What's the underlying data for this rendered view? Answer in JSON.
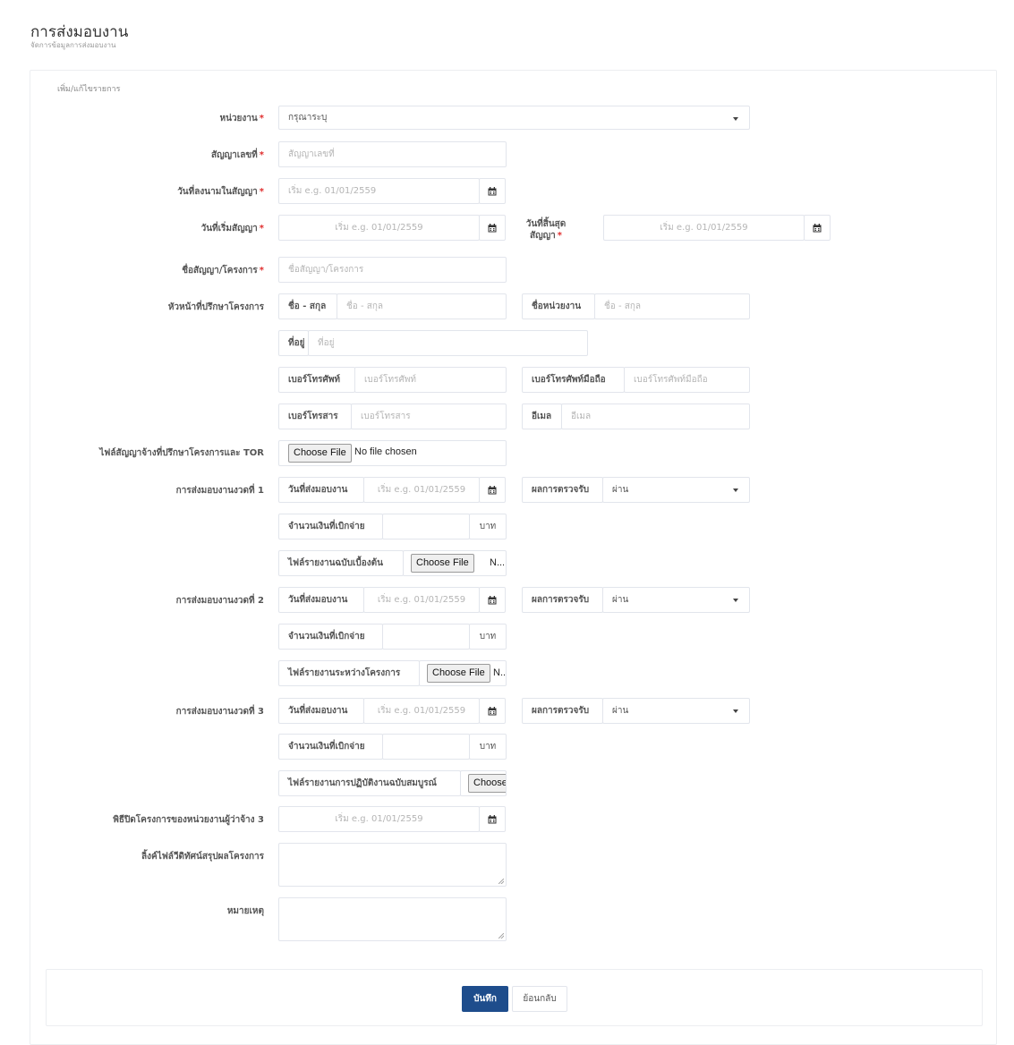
{
  "header": {
    "title": "การส่งมอบงาน",
    "subtitle": "จัดการข้อมูลการส่งมอบงาน"
  },
  "form": {
    "caption": "เพิ่ม/แก้ไขรายการ",
    "required_mark": "*",
    "agency": {
      "label": "หน่วยงาน",
      "value": "กรุณาระบุ"
    },
    "contract_no": {
      "label": "สัญญาเลขที่",
      "placeholder": "สัญญาเลขที่"
    },
    "sign_date": {
      "label": "วันที่ลงนามในสัญญา",
      "placeholder": "เริ่ม e.g. 01/01/2559"
    },
    "start_date": {
      "label": "วันที่เริ่มสัญญา",
      "placeholder": "เริ่ม e.g. 01/01/2559"
    },
    "end_date": {
      "label_line1": "วันที่สิ้นสุด",
      "label_line2": "สัญญา",
      "placeholder": "เริ่ม e.g. 01/01/2559"
    },
    "contract_name": {
      "label": "ชื่อสัญญา/โครงการ",
      "placeholder": "ชื่อสัญญา/โครงการ"
    },
    "advisor": {
      "label": "หัวหน้าที่ปรึกษาโครงการ",
      "name_addon": "ชื่อ - สกุล",
      "name_placeholder": "ชื่อ - สกุล",
      "org_addon": "ชื่อหน่วยงาน",
      "org_placeholder": "ชื่อ - สกุล",
      "address_addon": "ที่อยู่",
      "address_placeholder": "ที่อยู่",
      "phone_addon": "เบอร์โทรศัพท์",
      "phone_placeholder": "เบอร์โทรศัพท์",
      "mobile_addon": "เบอร์โทรศัพท์มือถือ",
      "mobile_placeholder": "เบอร์โทรศัพท์มือถือ",
      "fax_addon": "เบอร์โทรสาร",
      "fax_placeholder": "เบอร์โทรสาร",
      "email_addon": "อีเมล",
      "email_placeholder": "อีเมล"
    },
    "tor_file": {
      "label": "ไฟล์สัญญาจ้างที่ปรึกษาโครงการและ TOR",
      "button": "Choose File",
      "status": "No file chosen"
    },
    "installments": [
      {
        "label": "การส่งมอบงานงวดที่ 1",
        "date_addon": "วันที่ส่งมอบงาน",
        "date_placeholder": "เริ่ม e.g. 01/01/2559",
        "result_addon": "ผลการตรวจรับ",
        "result_value": "ผ่าน",
        "amount_addon": "จำนวนเงินที่เบิกจ่าย",
        "currency": "บาท",
        "file_addon": "ไฟล์รายงานฉบับเบื้องต้น",
        "file_button": "Choose File",
        "file_status": "N..."
      },
      {
        "label": "การส่งมอบงานงวดที่ 2",
        "date_addon": "วันที่ส่งมอบงาน",
        "date_placeholder": "เริ่ม e.g. 01/01/2559",
        "result_addon": "ผลการตรวจรับ",
        "result_value": "ผ่าน",
        "amount_addon": "จำนวนเงินที่เบิกจ่าย",
        "currency": "บาท",
        "file_addon": "ไฟล์รายงานระหว่างโครงการ",
        "file_button": "Choose File",
        "file_status": "N..."
      },
      {
        "label": "การส่งมอบงานงวดที่ 3",
        "date_addon": "วันที่ส่งมอบงาน",
        "date_placeholder": "เริ่ม e.g. 01/01/2559",
        "result_addon": "ผลการตรวจรับ",
        "result_value": "ผ่าน",
        "amount_addon": "จำนวนเงินที่เบิกจ่าย",
        "currency": "บาท",
        "file_addon": "ไฟล์รายงานการปฏิบัติงานฉบับสมบูรณ์",
        "file_button": "Choose",
        "file_status": ""
      }
    ],
    "closing_ceremony": {
      "label": "พิธีปิดโครงการของหน่วยงานผู้ว่าจ้าง 3",
      "placeholder": "เริ่ม e.g. 01/01/2559"
    },
    "video_link": {
      "label": "ลิ้งค์ไฟล์วีดิทัศน์สรุปผลโครงการ",
      "value": ""
    },
    "remark": {
      "label": "หมายเหตุ",
      "value": ""
    }
  },
  "actions": {
    "save": "บันทึก",
    "back": "ย้อนกลับ"
  }
}
